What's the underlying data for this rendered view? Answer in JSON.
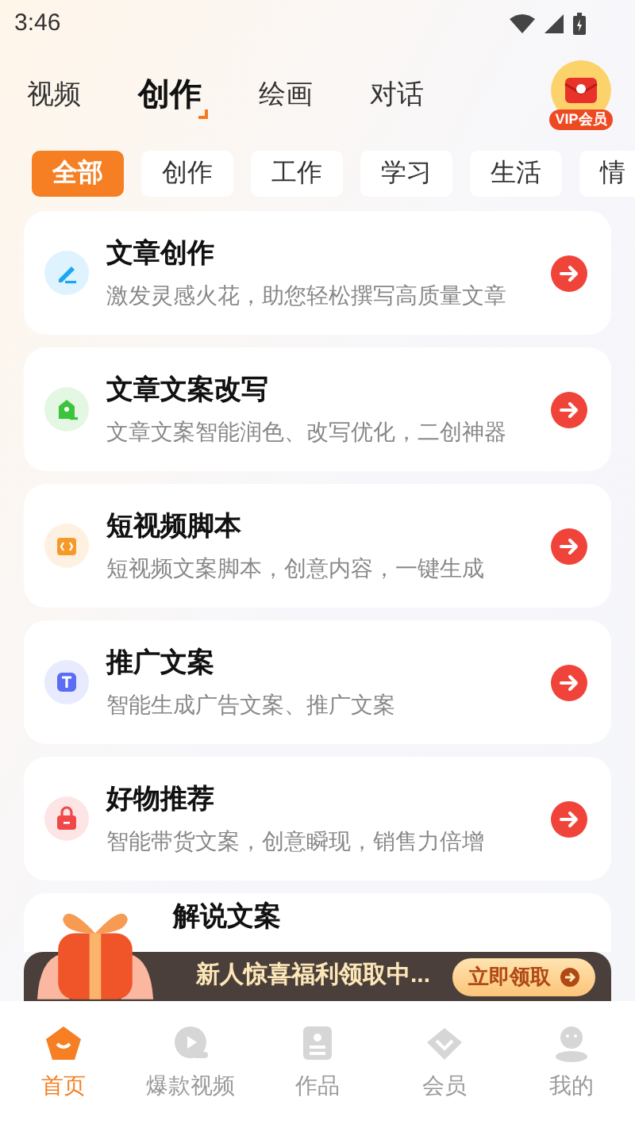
{
  "status_bar": {
    "time": "3:46"
  },
  "top_tabs": [
    {
      "label": "视频",
      "selected": false
    },
    {
      "label": "创作",
      "selected": true
    },
    {
      "label": "绘画",
      "selected": false
    },
    {
      "label": "对话",
      "selected": false
    }
  ],
  "vip_badge": {
    "label": "VIP会员"
  },
  "chips": [
    {
      "label": "全部",
      "selected": true
    },
    {
      "label": "创作",
      "selected": false
    },
    {
      "label": "工作",
      "selected": false
    },
    {
      "label": "学习",
      "selected": false
    },
    {
      "label": "生活",
      "selected": false
    },
    {
      "label": "情",
      "selected": false
    }
  ],
  "cards": [
    {
      "kind": "pen",
      "color": "#1aa7f5",
      "title": "文章创作",
      "description": "激发灵感火花，助您轻松撰写高质量文章"
    },
    {
      "kind": "rewrite",
      "color": "#3cc43c",
      "title": "文章文案改写",
      "description": "文章文案智能润色、改写优化，二创神器"
    },
    {
      "kind": "code",
      "color": "#f59a2a",
      "title": "短视频脚本",
      "description": "短视频文案脚本，创意内容，一键生成"
    },
    {
      "kind": "text",
      "color": "#5b6cf5",
      "title": "推广文案",
      "description": "智能生成广告文案、推广文案"
    },
    {
      "kind": "bag",
      "color": "#f04848",
      "title": "好物推荐",
      "description": "智能带货文案，创意瞬现，销售力倍增"
    },
    {
      "kind": "none",
      "title": "解说文案"
    }
  ],
  "promo_banner": {
    "text": "新人惊喜福利领取中...",
    "button": "立即领取"
  },
  "bottom_nav": [
    {
      "kind": "home",
      "label": "首页",
      "selected": true
    },
    {
      "kind": "video",
      "label": "爆款视频",
      "selected": false
    },
    {
      "kind": "works",
      "label": "作品",
      "selected": false
    },
    {
      "kind": "member",
      "label": "会员",
      "selected": false
    },
    {
      "kind": "me",
      "label": "我的",
      "selected": false
    }
  ]
}
